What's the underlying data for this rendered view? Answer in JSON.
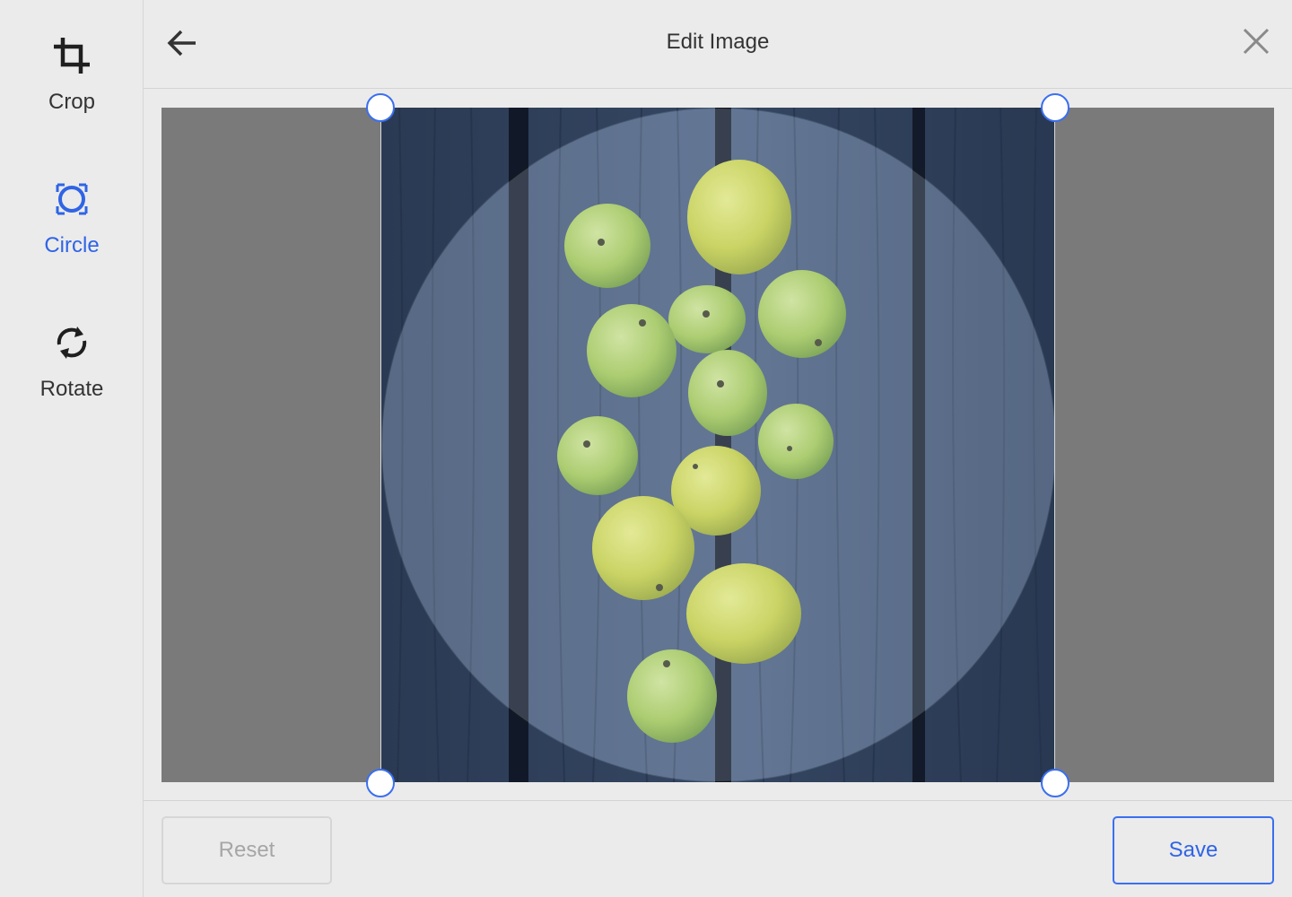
{
  "header": {
    "title": "Edit Image"
  },
  "tools": [
    {
      "id": "crop",
      "label": "Crop",
      "icon": "crop-icon",
      "active": false
    },
    {
      "id": "circle",
      "label": "Circle",
      "icon": "circle-icon",
      "active": true
    },
    {
      "id": "rotate",
      "label": "Rotate",
      "icon": "rotate-icon",
      "active": false
    }
  ],
  "footer": {
    "reset_label": "Reset",
    "save_label": "Save"
  },
  "colors": {
    "accent": "#2f64e6",
    "canvas": "#7a7a7a",
    "background": "#ebebeb"
  }
}
